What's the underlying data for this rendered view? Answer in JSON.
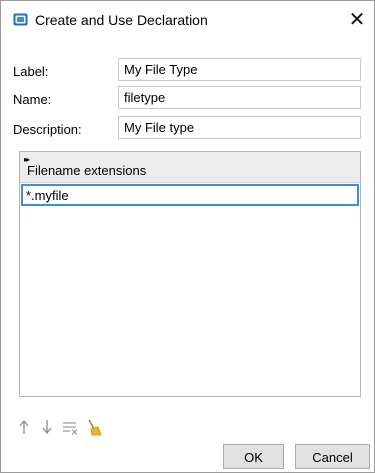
{
  "dialog": {
    "title": "Create and Use Declaration",
    "close_glyph": "✕",
    "icon": "app-window-icon"
  },
  "form": {
    "label": {
      "caption": "Label:",
      "value": "My File Type"
    },
    "name": {
      "caption": "Name:",
      "value": "filetype"
    },
    "description": {
      "caption": "Description:",
      "value": "My File type"
    }
  },
  "extensions": {
    "header": "Filename extensions",
    "expand_glyph": "▸▸",
    "rows": [
      "*.myfile"
    ],
    "selected_border_color": "#3e8fd6"
  },
  "toolbar": {
    "icons": [
      "arrow-up-icon",
      "arrow-down-icon",
      "delete-list-icon",
      "clear-broom-icon"
    ]
  },
  "buttons": {
    "ok": "OK",
    "cancel": "Cancel"
  },
  "colors": {
    "icon_blue": "#1e6fc7",
    "broom_yellow": "#f0b429"
  }
}
